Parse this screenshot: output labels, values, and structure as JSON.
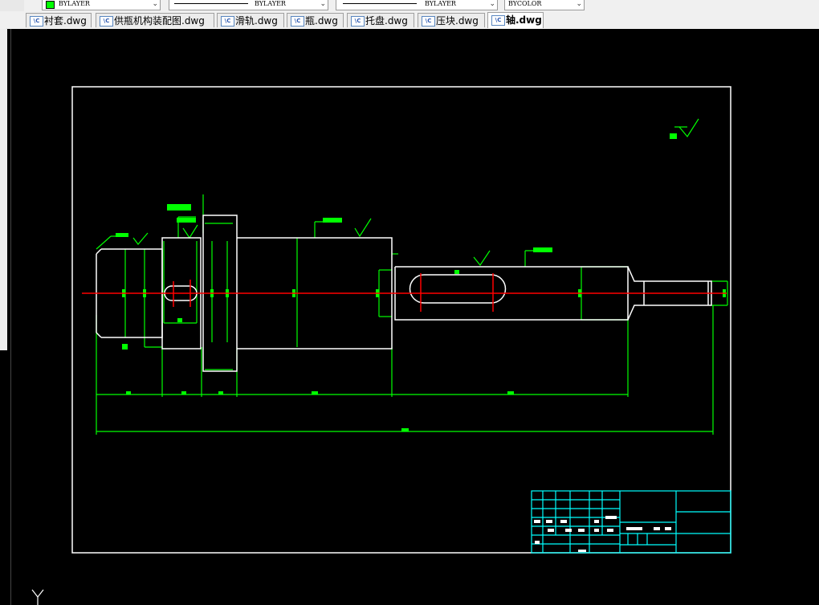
{
  "toolbar": {
    "color_value": "BYLAYER",
    "color_swatch": "#00ff00",
    "linetype_value": "BYLAYER",
    "lineweight_value": "BYLAYER",
    "plotstyle_value": "BYCOLOR"
  },
  "tabs": [
    {
      "label": "衬套.dwg",
      "active": false
    },
    {
      "label": "供瓶机构装配图.dwg",
      "active": false
    },
    {
      "label": "滑轨.dwg",
      "active": false
    },
    {
      "label": "瓶.dwg",
      "active": false
    },
    {
      "label": "托盘.dwg",
      "active": false
    },
    {
      "label": "压块.dwg",
      "active": false
    },
    {
      "label": "轴.dwg",
      "active": true
    }
  ],
  "tab_icon_text": "\\C",
  "drawing": {
    "background": "#000000",
    "outline_color": "#ffffff",
    "dimension_color": "#00ff00",
    "centerline_color": "#ff0000",
    "titleblock_color": "#00ffff",
    "ucs_label": "Y"
  }
}
